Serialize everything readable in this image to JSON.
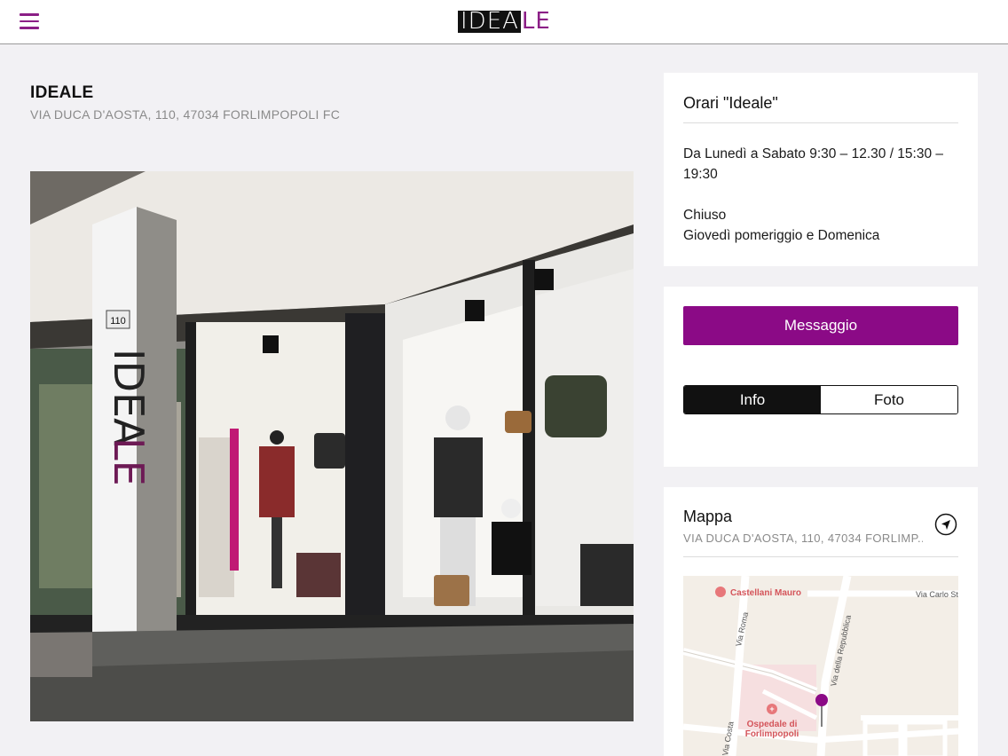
{
  "header": {
    "menu_icon": "hamburger-menu-icon",
    "logo_highlight": "IDEA",
    "logo_rest": "LE",
    "accent_color": "#8b1f86"
  },
  "store": {
    "name": "IDEALE",
    "address": "VIA DUCA D'AOSTA, 110, 47034 FORLIMPOPOLI FC",
    "photo_sign_number": "110"
  },
  "hours": {
    "title": "Orari \"Ideale\"",
    "open_text": "Da Lunedì a Sabato 9:30 – 12.30 / 15:30 – 19:30",
    "closed_label": "Chiuso",
    "closed_days": "Giovedì pomeriggio e Domenica"
  },
  "actions": {
    "message_label": "Messaggio",
    "message_color": "#8b0a86",
    "tabs": [
      {
        "label": "Info",
        "active": true
      },
      {
        "label": "Foto",
        "active": false
      }
    ]
  },
  "map": {
    "title": "Mappa",
    "address": "VIA DUCA D'AOSTA, 110, 47034 FORLIMP...",
    "navigate_icon": "navigation-arrow-icon",
    "poi_castellani": "Castellani Mauro",
    "poi_hospital_line1": "Ospedale di",
    "poi_hospital_line2": "Forlimpopoli",
    "street_roma": "Via Roma",
    "street_repubblica": "Via della Repubblica",
    "street_carlo": "Via Carlo St",
    "street_costa": "Via Costa"
  }
}
